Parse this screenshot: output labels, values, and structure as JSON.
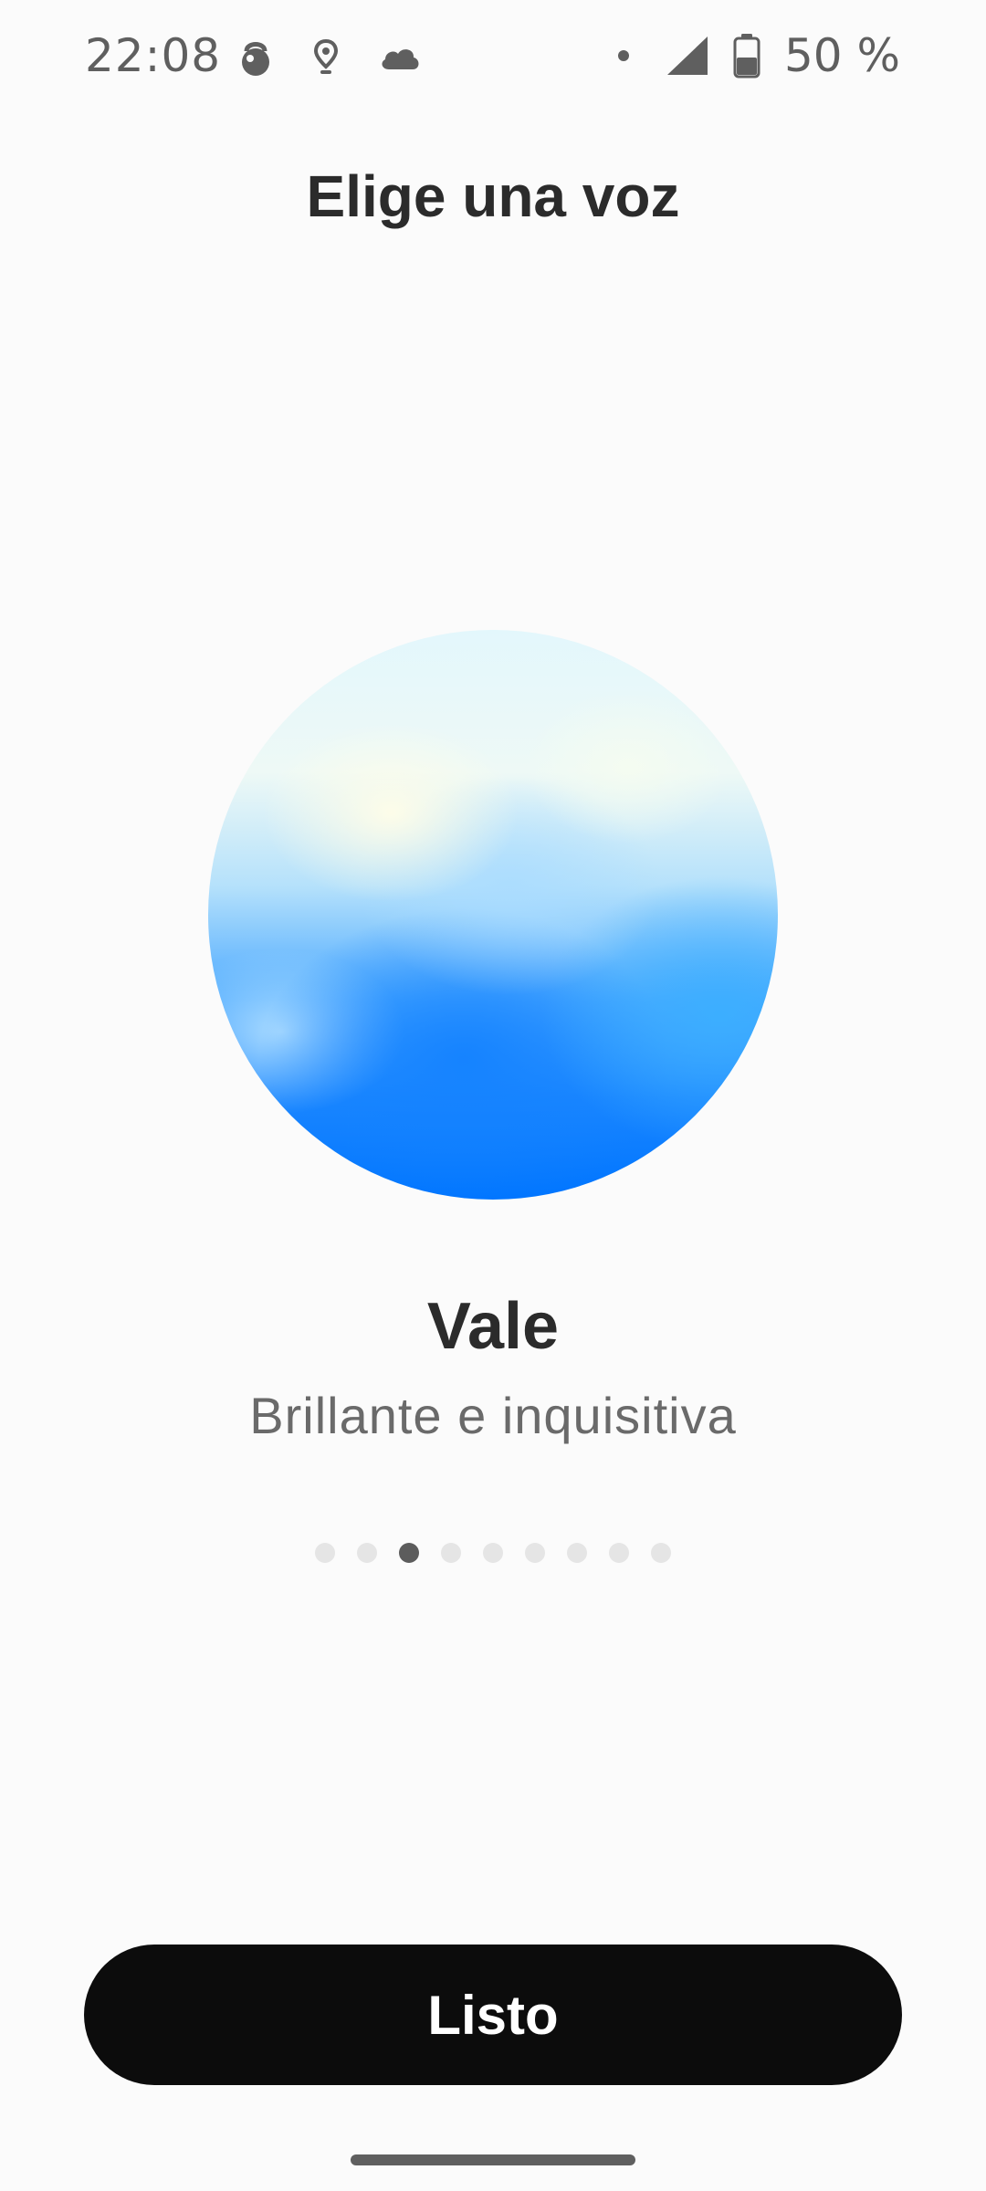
{
  "status_bar": {
    "time": "22:08",
    "battery_text": "50 %",
    "icons": [
      "kettlebell-icon",
      "location-icon",
      "cloud-icon",
      "notification-dot-icon",
      "cell-signal-icon",
      "battery-icon"
    ]
  },
  "title": "Elige una voz",
  "voice": {
    "name": "Vale",
    "description": "Brillante e inquisitiva"
  },
  "pager": {
    "count": 9,
    "active_index": 2
  },
  "done_button": {
    "label": "Listo"
  },
  "colors": {
    "background": "#fbfbfb",
    "text_primary": "#2b2b2b",
    "text_secondary": "#6a6a6a",
    "button_bg": "#0c0c0c",
    "orb_blue": "#0075ff",
    "indicator_active": "#5c5c5c",
    "indicator_inactive": "#e5e5e5"
  }
}
